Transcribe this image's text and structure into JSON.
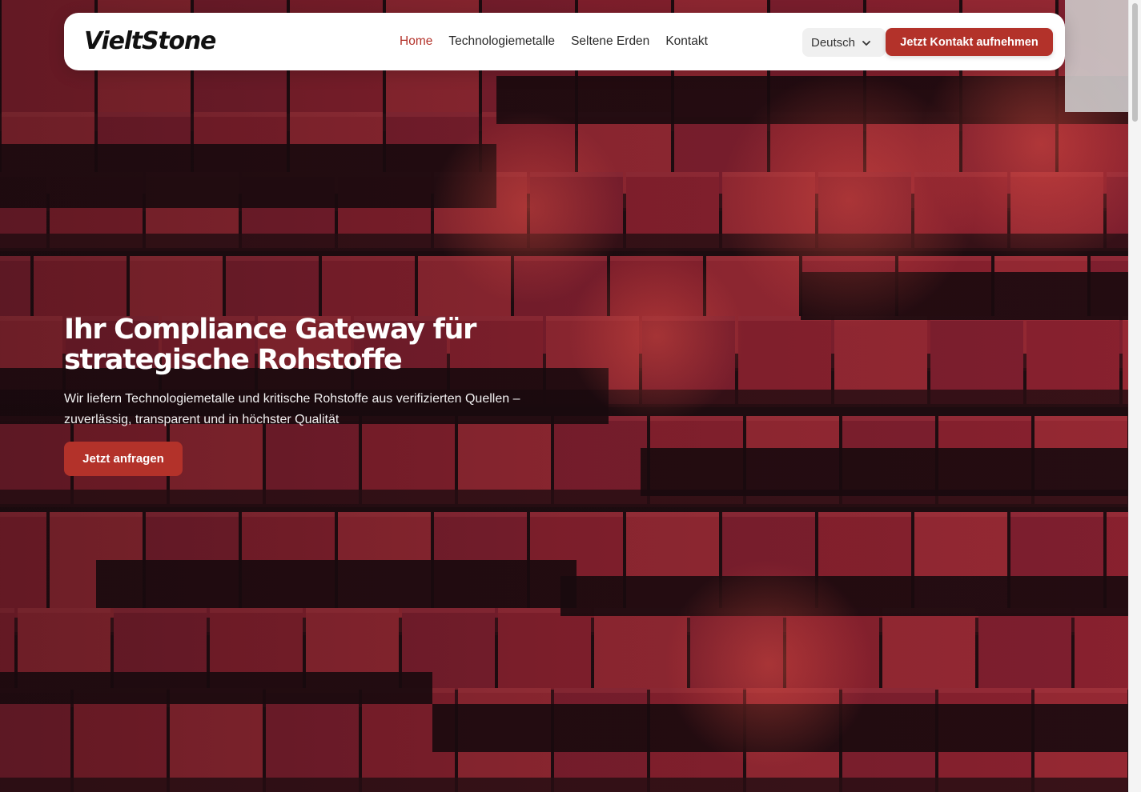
{
  "header": {
    "logo_text": "VieltStone",
    "nav": [
      {
        "label": "Home",
        "active": true
      },
      {
        "label": "Technologiemetalle",
        "active": false
      },
      {
        "label": "Seltene Erden",
        "active": false
      },
      {
        "label": "Kontakt",
        "active": false
      }
    ],
    "language": {
      "selected": "Deutsch",
      "icon": "chevron-down-icon"
    },
    "cta_label": "Jetzt Kontakt aufnehmen"
  },
  "hero": {
    "title_line_1": "Ihr Compliance Gateway für",
    "title_line_2": "strategische Rohstoffe",
    "subtitle_line_1": "Wir liefern Technologiemetalle und kritische Rohstoffe aus verifizierten Quellen –",
    "subtitle_line_2": "zuverlässig, transparent und in höchster Qualität",
    "cta_label": "Jetzt anfragen"
  },
  "colors": {
    "accent": "#b3322a",
    "header_bg": "#ffffff",
    "hero_red": "#8e2230",
    "hero_shadow": "#1e0c10"
  }
}
